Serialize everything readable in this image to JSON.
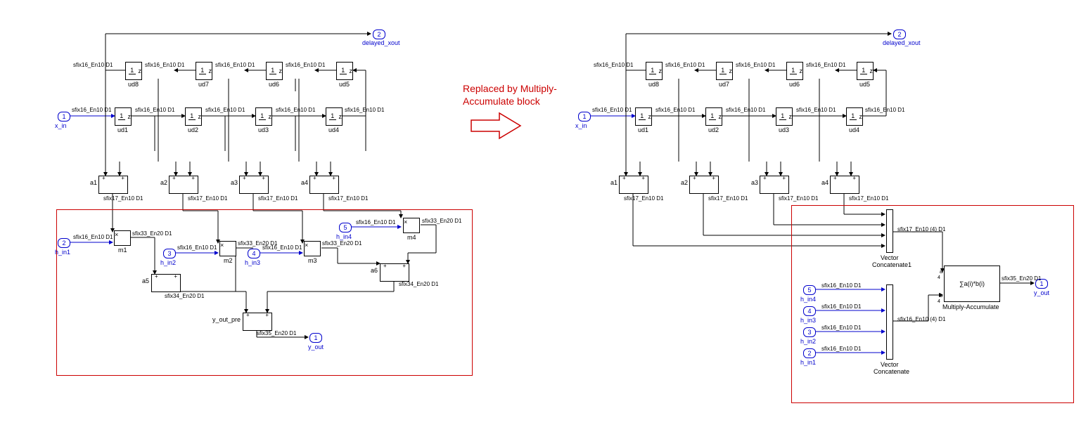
{
  "center": {
    "text1": "Replaced by Multiply-",
    "text2": "Accumulate block"
  },
  "ports": {
    "x_in": {
      "num": "1",
      "label": "x_in"
    },
    "delayed_xout": {
      "num": "2",
      "label": "delayed_xout"
    },
    "h_in1": {
      "num": "2",
      "label": "h_in1"
    },
    "h_in2": {
      "num": "3",
      "label": "h_in2"
    },
    "h_in3": {
      "num": "4",
      "label": "h_in3"
    },
    "h_in4": {
      "num": "5",
      "label": "h_in4"
    },
    "y_out": {
      "num": "1",
      "label": "y_out"
    }
  },
  "delays": {
    "ud1": "ud1",
    "ud2": "ud2",
    "ud3": "ud3",
    "ud4": "ud4",
    "ud5": "ud5",
    "ud6": "ud6",
    "ud7": "ud7",
    "ud8": "ud8"
  },
  "adders": {
    "a1": "a1",
    "a2": "a2",
    "a3": "a3",
    "a4": "a4",
    "a5": "a5",
    "a6": "a6"
  },
  "mults": {
    "m1": "m1",
    "m2": "m2",
    "m3": "m3",
    "m4": "m4"
  },
  "signals": {
    "sfix16_En10_D1": "sfix16_En10 D1",
    "sfix17_En10_D1": "sfix17_En10 D1",
    "sfix33_En20_D1": "sfix33_En20 D1",
    "sfix34_En20_D1": "sfix34_En20 D1",
    "sfix35_En20_D1": "sfix35_En20 D1",
    "sfix17_En10_4_D1": "sfix17_En10 (4) D1",
    "sfix16_En10_4_D1": "sfix16_En10 (4) D1"
  },
  "misc": {
    "y_out_pre": "y_out_pre",
    "vector_concat": "Vector",
    "vector_concat2": "Concatenate",
    "vector_concat1_label": "Concatenate1",
    "mac_label": "Multiply-Accumulate",
    "mac_text": "∑a(i)*b(i)",
    "a": "a",
    "b": "b",
    "four": "4"
  },
  "chart_data": {
    "type": "block-diagram",
    "description": "Simulink FIR filter structure replaced by Multiply-Accumulate block",
    "left_diagram": {
      "inputs": [
        "x_in",
        "h_in1",
        "h_in2",
        "h_in3",
        "h_in4"
      ],
      "outputs": [
        "delayed_xout",
        "y_out"
      ],
      "delays_top": [
        "ud8",
        "ud7",
        "ud6",
        "ud5"
      ],
      "delays_bottom": [
        "ud1",
        "ud2",
        "ud3",
        "ud4"
      ],
      "adders_pre": [
        "a1",
        "a2",
        "a3",
        "a4"
      ],
      "multipliers": [
        "m1",
        "m2",
        "m3",
        "m4"
      ],
      "adders_post": [
        "a5",
        "a6",
        "y_out_pre"
      ]
    },
    "right_diagram": {
      "inputs": [
        "x_in",
        "h_in1",
        "h_in2",
        "h_in3",
        "h_in4"
      ],
      "outputs": [
        "delayed_xout",
        "y_out"
      ],
      "delays_top": [
        "ud8",
        "ud7",
        "ud6",
        "ud5"
      ],
      "delays_bottom": [
        "ud1",
        "ud2",
        "ud3",
        "ud4"
      ],
      "adders_pre": [
        "a1",
        "a2",
        "a3",
        "a4"
      ],
      "concat_blocks": [
        "Vector Concatenate1",
        "Vector Concatenate"
      ],
      "mac": "Multiply-Accumulate"
    }
  }
}
